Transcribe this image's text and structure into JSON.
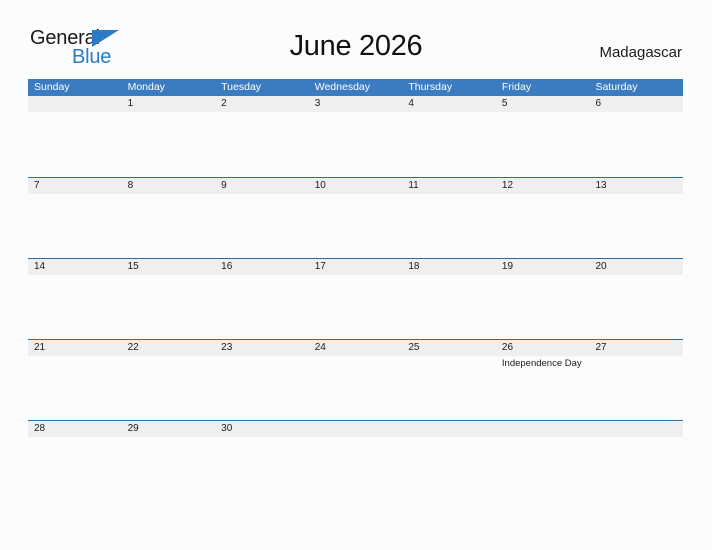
{
  "brand": {
    "name_part1": "General",
    "name_part2": "Blue",
    "triangle_icon": "blue-triangle-icon",
    "color_dark": "#1b1b1b",
    "color_blue": "#2a7ac4"
  },
  "header": {
    "title": "June 2026",
    "locale": "Madagascar"
  },
  "theme": {
    "header_blue": "#3b7cc1",
    "row_rule_blue": "#2e6da4",
    "day_band_gray": "#efefef",
    "page_background": "#fbfcfd"
  },
  "calendar": {
    "month": "June",
    "year": "2026",
    "weekday_headers": [
      "Sunday",
      "Monday",
      "Tuesday",
      "Wednesday",
      "Thursday",
      "Friday",
      "Saturday"
    ],
    "weeks": [
      {
        "days": [
          {
            "date": "",
            "events": []
          },
          {
            "date": "1",
            "events": []
          },
          {
            "date": "2",
            "events": []
          },
          {
            "date": "3",
            "events": []
          },
          {
            "date": "4",
            "events": []
          },
          {
            "date": "5",
            "events": []
          },
          {
            "date": "6",
            "events": []
          }
        ]
      },
      {
        "days": [
          {
            "date": "7",
            "events": []
          },
          {
            "date": "8",
            "events": []
          },
          {
            "date": "9",
            "events": []
          },
          {
            "date": "10",
            "events": []
          },
          {
            "date": "11",
            "events": []
          },
          {
            "date": "12",
            "events": []
          },
          {
            "date": "13",
            "events": []
          }
        ]
      },
      {
        "days": [
          {
            "date": "14",
            "events": []
          },
          {
            "date": "15",
            "events": []
          },
          {
            "date": "16",
            "events": []
          },
          {
            "date": "17",
            "events": []
          },
          {
            "date": "18",
            "events": []
          },
          {
            "date": "19",
            "events": []
          },
          {
            "date": "20",
            "events": []
          }
        ]
      },
      {
        "days": [
          {
            "date": "21",
            "events": []
          },
          {
            "date": "22",
            "events": []
          },
          {
            "date": "23",
            "events": []
          },
          {
            "date": "24",
            "events": []
          },
          {
            "date": "25",
            "events": []
          },
          {
            "date": "26",
            "events": [
              "Independence Day"
            ]
          },
          {
            "date": "27",
            "events": []
          }
        ]
      },
      {
        "days": [
          {
            "date": "28",
            "events": []
          },
          {
            "date": "29",
            "events": []
          },
          {
            "date": "30",
            "events": []
          },
          {
            "date": "",
            "events": []
          },
          {
            "date": "",
            "events": []
          },
          {
            "date": "",
            "events": []
          },
          {
            "date": "",
            "events": []
          }
        ]
      }
    ]
  }
}
